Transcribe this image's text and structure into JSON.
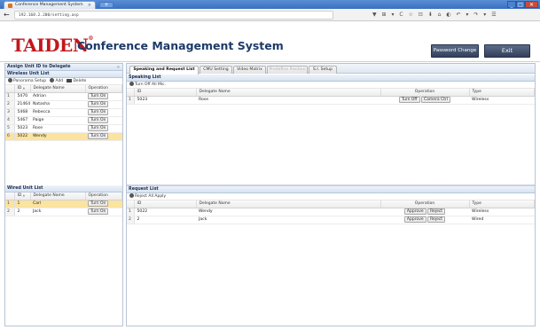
{
  "browser": {
    "tab_title": "Conference Management System",
    "tab_close": "×",
    "new_tab": "+",
    "url": "192.168.2.200/setting.asp",
    "back": "←",
    "tools": "▼ ⊞ ▾ C ☆ ⊡ ⬇ ⌂ ◐ ↶ ▾ ↷ ▾ ☰",
    "win_min": "_",
    "win_max": "□",
    "win_close": "✕"
  },
  "header": {
    "logo": "TAIDEN",
    "logo_mark": "®",
    "title": "Conference Management System",
    "password_change": "Password Change",
    "exit": "Exit"
  },
  "left": {
    "assign_title": "Assign Unit ID to Delegate",
    "collapse": "«",
    "wireless": {
      "title": "Wireless Unit List",
      "toolbar": {
        "panorama": "Panorama Setup",
        "add": "Add",
        "delete": "Delete"
      },
      "columns": [
        "ID",
        "Delegate Name",
        "Operation"
      ],
      "sort_mark": "▲",
      "rows": [
        {
          "n": "1",
          "id": "5470",
          "name": "Adrian",
          "op": "Turn On"
        },
        {
          "n": "2",
          "id": "21464",
          "name": "Natasha",
          "op": "Turn On"
        },
        {
          "n": "3",
          "id": "5468",
          "name": "Rebecca",
          "op": "Turn On"
        },
        {
          "n": "4",
          "id": "5467",
          "name": "Paige",
          "op": "Turn On"
        },
        {
          "n": "5",
          "id": "5023",
          "name": "Rose",
          "op": "Turn On"
        },
        {
          "n": "6",
          "id": "5022",
          "name": "Wendy",
          "op": "Turn On"
        }
      ]
    },
    "wired": {
      "title": "Wired Unit List",
      "columns": [
        "ID",
        "Delegate Name",
        "Operation"
      ],
      "sort_mark": "▲",
      "rows": [
        {
          "n": "1",
          "id": "1",
          "name": "Carl",
          "op": "Turn On"
        },
        {
          "n": "2",
          "id": "2",
          "name": "Jack",
          "op": "Turn On"
        }
      ]
    }
  },
  "right": {
    "tabs": [
      "Speaking and Request List",
      "CMU Setting",
      "Video Matrix",
      "Predefine Position",
      "S.I. Setup"
    ],
    "speaking": {
      "title": "Speaking List",
      "toolbar_label": "Turn Off All Mic.",
      "columns": [
        "ID",
        "Delegate Name",
        "Operation",
        "Type"
      ],
      "rows": [
        {
          "n": "1",
          "id": "5023",
          "name": "Rose",
          "btn1": "Turn Off",
          "btn2": "Camera Ctrl",
          "type": "Wireless"
        }
      ]
    },
    "request": {
      "title": "Request List",
      "toolbar_label": "Reject All Apply",
      "columns": [
        "ID",
        "Delegate Name",
        "Operation",
        "Type"
      ],
      "rows": [
        {
          "n": "1",
          "id": "5022",
          "name": "Wendy",
          "btn1": "Approve",
          "btn2": "Reject",
          "type": "Wireless"
        },
        {
          "n": "2",
          "id": "2",
          "name": "Jack",
          "btn1": "Approve",
          "btn2": "Reject",
          "type": "Wired"
        }
      ]
    }
  }
}
